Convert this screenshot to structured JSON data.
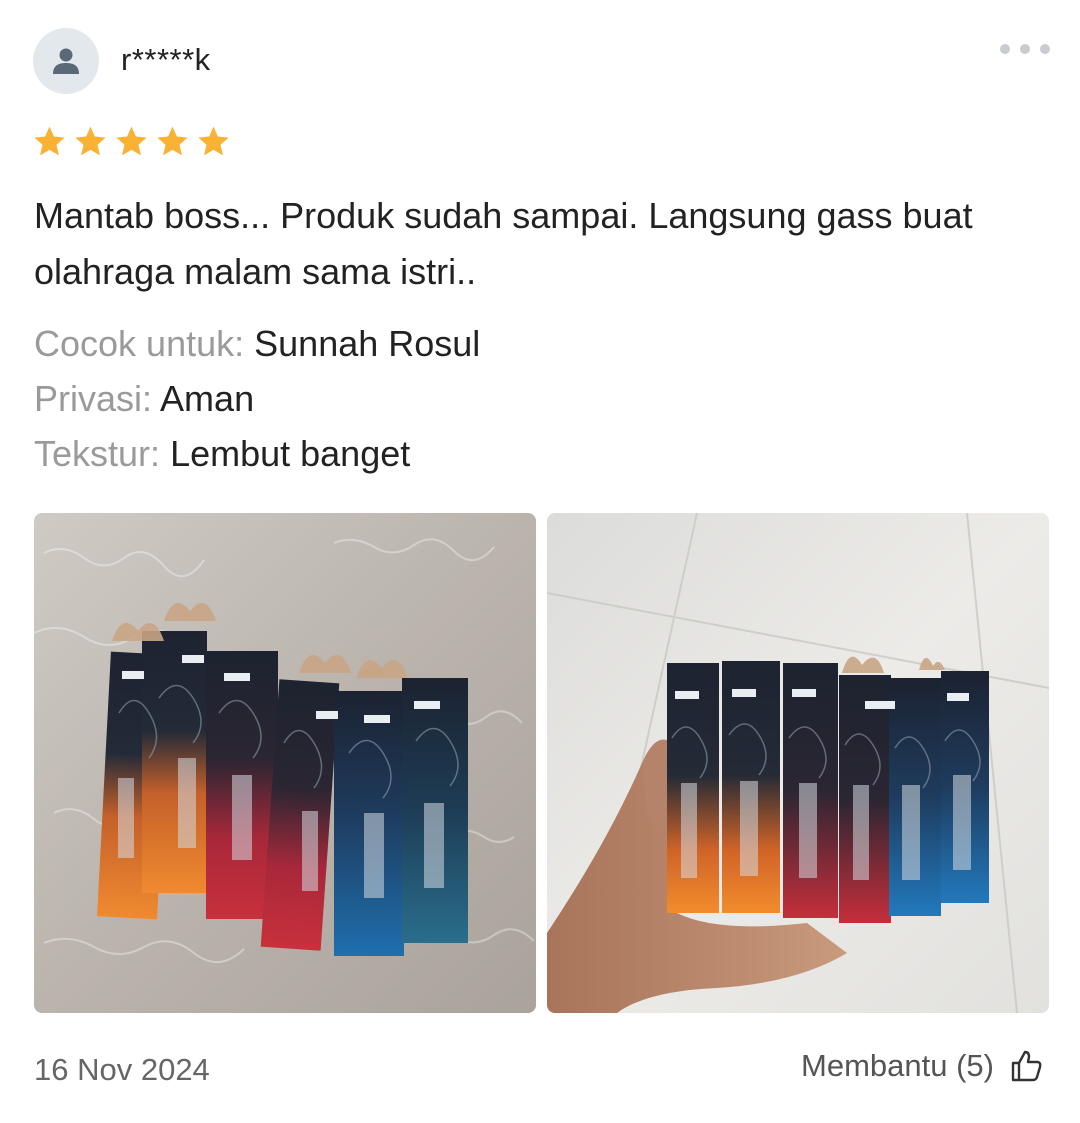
{
  "review": {
    "username": "r*****k",
    "rating": 5,
    "rating_max": 5,
    "text": "Mantab boss... Produk sudah sampai. Langsung gass buat olahraga malam sama istri..",
    "attributes": [
      {
        "label": "Cocok untuk:",
        "value": "Sunnah Rosul"
      },
      {
        "label": "Privasi:",
        "value": "Aman"
      },
      {
        "label": "Tekstur:",
        "value": "Lembut banget"
      }
    ],
    "date": "16 Nov 2024",
    "helpful_label": "Membantu (5)"
  },
  "photos": [
    {
      "subject": "product boxes on fluffy carpet"
    },
    {
      "subject": "product boxes held in hand"
    }
  ],
  "icons": {
    "avatar": "user-icon",
    "more": "more-dots-icon",
    "star": "star-icon",
    "helpful": "thumbs-up-icon"
  },
  "colors": {
    "star": "#f9b233",
    "muted_label": "#9a9a9a",
    "avatar_bg": "#e3e8ed",
    "avatar_fg": "#5b6976"
  }
}
